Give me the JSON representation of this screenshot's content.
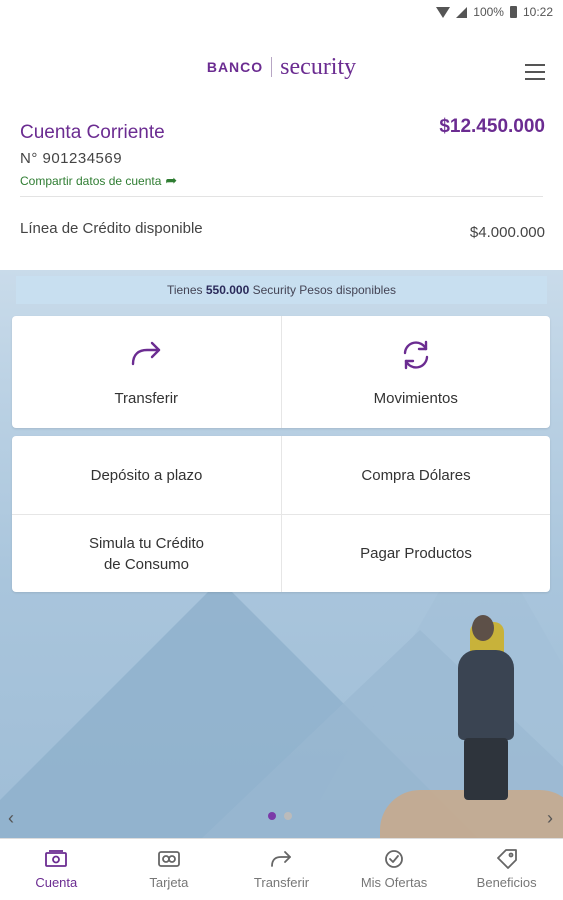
{
  "status_bar": {
    "battery": "100%",
    "time": "10:22"
  },
  "brand": {
    "banco": "BANCO",
    "security": "security"
  },
  "account": {
    "title": "Cuenta Corriente",
    "balance": "$12.450.000",
    "number": "N° 901234569",
    "share_label": "Compartir datos de cuenta",
    "credit_label": "Línea de Crédito disponible",
    "credit_value": "$4.000.000"
  },
  "points_banner": {
    "prefix": "Tienes",
    "amount": "550.000",
    "suffix": "Security Pesos disponibles"
  },
  "actions": {
    "transferir": "Transferir",
    "movimientos": "Movimientos",
    "deposito": "Depósito a plazo",
    "compra_dolares": "Compra Dólares",
    "simula_line1": "Simula tu Crédito",
    "simula_line2": "de Consumo",
    "pagar": "Pagar Productos"
  },
  "carousel": {
    "active_index": 0,
    "count": 2
  },
  "bottom_nav": [
    {
      "label": "Cuenta",
      "icon": "money-icon",
      "active": true
    },
    {
      "label": "Tarjeta",
      "icon": "card-icon",
      "active": false
    },
    {
      "label": "Transferir",
      "icon": "transfer-icon",
      "active": false
    },
    {
      "label": "Mis Ofertas",
      "icon": "check-circle-icon",
      "active": false
    },
    {
      "label": "Beneficios",
      "icon": "tag-icon",
      "active": false
    }
  ],
  "colors": {
    "accent": "#6b2c91",
    "share_green": "#2f7d32"
  }
}
